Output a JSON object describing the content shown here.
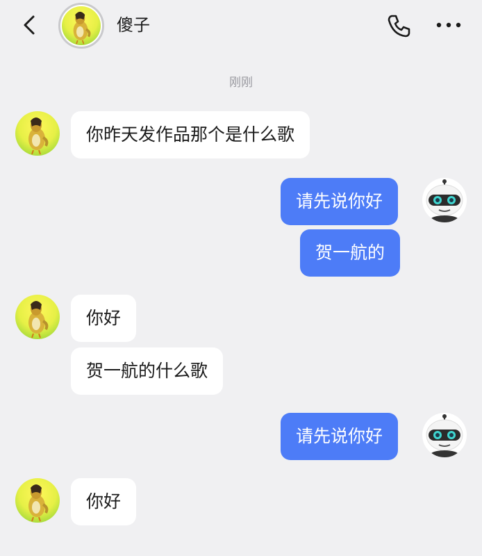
{
  "header": {
    "title": "傻子",
    "back_icon": "chevron-left-icon",
    "call_icon": "phone-icon",
    "more_icon": "more-dots-icon"
  },
  "timestamp": "刚刚",
  "colors": {
    "background": "#f0f0f2",
    "incoming_bubble": "#ffffff",
    "outgoing_bubble": "#4d7cf7",
    "timestamp_text": "#9a9aa0"
  },
  "messages": [
    {
      "sender": "contact",
      "text": "你昨天发作品那个是什么歌"
    },
    {
      "sender": "me",
      "text": "请先说你好"
    },
    {
      "sender": "me",
      "text": "贺一航的"
    },
    {
      "sender": "contact",
      "text": "你好"
    },
    {
      "sender": "contact",
      "text": "贺一航的什么歌"
    },
    {
      "sender": "me",
      "text": "请先说你好"
    },
    {
      "sender": "contact",
      "text": "你好"
    }
  ]
}
